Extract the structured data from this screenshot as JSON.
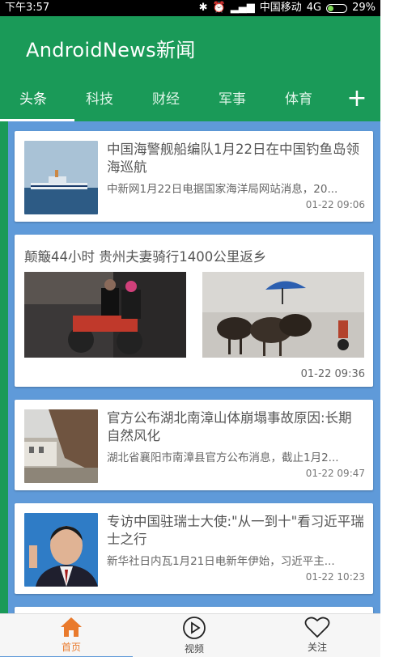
{
  "status_bar": {
    "time": "下午3:57",
    "carrier": "中国移动",
    "network": "4G",
    "battery": "29%",
    "battery_level": 0.29
  },
  "app": {
    "title": "AndroidNews新闻",
    "accent_color": "#1a9a58",
    "feed_bg_color": "#5f9ad9"
  },
  "tabs": [
    {
      "label": "头条",
      "active": true
    },
    {
      "label": "科技",
      "active": false
    },
    {
      "label": "财经",
      "active": false
    },
    {
      "label": "军事",
      "active": false
    },
    {
      "label": "体育",
      "active": false
    }
  ],
  "tab_add_icon": "plus-icon",
  "feed": {
    "items": [
      {
        "title": "中国海警舰船编队1月22日在中国钓鱼岛领海巡航",
        "snippet": "中新网1月22日电据国家海洋局网站消息，20...",
        "time": "01-22 09:06"
      },
      {
        "title": "颠簸44小时 贵州夫妻骑行1400公里返乡",
        "time": "01-22 09:36"
      },
      {
        "title": "官方公布湖北南漳山体崩塌事故原因:长期自然风化",
        "snippet": "湖北省襄阳市南漳县官方公布消息，截止1月2...",
        "time": "01-22 09:47"
      },
      {
        "title": "专访中国驻瑞士大使:\"从一到十\"看习近平瑞士之行",
        "snippet": "新华社日内瓦1月21日电新年伊始，习近平主...",
        "time": "01-22 10:23"
      }
    ]
  },
  "bottom_nav": [
    {
      "label": "首页",
      "icon": "home-icon",
      "active": true
    },
    {
      "label": "视频",
      "icon": "play-circle-icon",
      "active": false
    },
    {
      "label": "关注",
      "icon": "heart-icon",
      "active": false
    }
  ],
  "active_color": "#e97a2c"
}
